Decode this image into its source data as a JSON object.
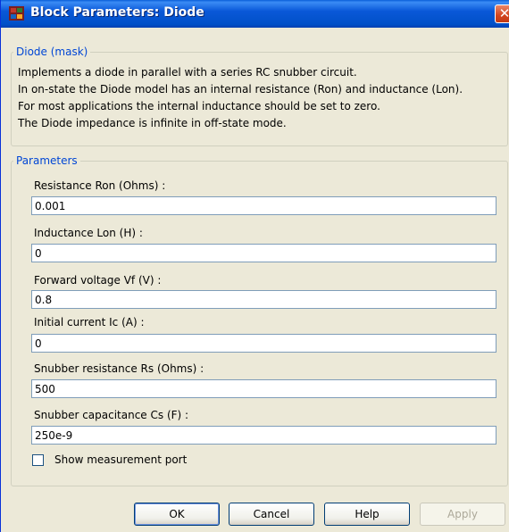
{
  "window": {
    "title": "Block Parameters: Diode",
    "close_glyph": "✕"
  },
  "mask": {
    "legend": "Diode (mask)",
    "description": [
      "Implements a diode in parallel with a series RC snubber circuit.",
      "In on-state the Diode model has an internal resistance (Ron) and inductance (Lon).",
      "For most applications the internal inductance should be set to zero.",
      "The Diode impedance is infinite in off-state mode."
    ]
  },
  "parameters": {
    "legend": "Parameters",
    "fields": [
      {
        "label": "Resistance Ron (Ohms) :",
        "value": "0.001"
      },
      {
        "label": "Inductance Lon (H) :",
        "value": "0"
      },
      {
        "label": "Forward voltage Vf (V) :",
        "value": "0.8"
      },
      {
        "label": "Initial current Ic (A) :",
        "value": "0"
      },
      {
        "label": "Snubber resistance Rs (Ohms) :",
        "value": "500"
      },
      {
        "label": "Snubber capacitance Cs (F) :",
        "value": "250e-9"
      }
    ],
    "show_measurement_port": {
      "label": "Show measurement port",
      "checked": false
    }
  },
  "buttons": {
    "ok": "OK",
    "cancel": "Cancel",
    "help": "Help",
    "apply": "Apply"
  },
  "colors": {
    "title_bar": "#0054e3",
    "legend_text": "#0046d5",
    "dialog_bg": "#ece9d8"
  }
}
